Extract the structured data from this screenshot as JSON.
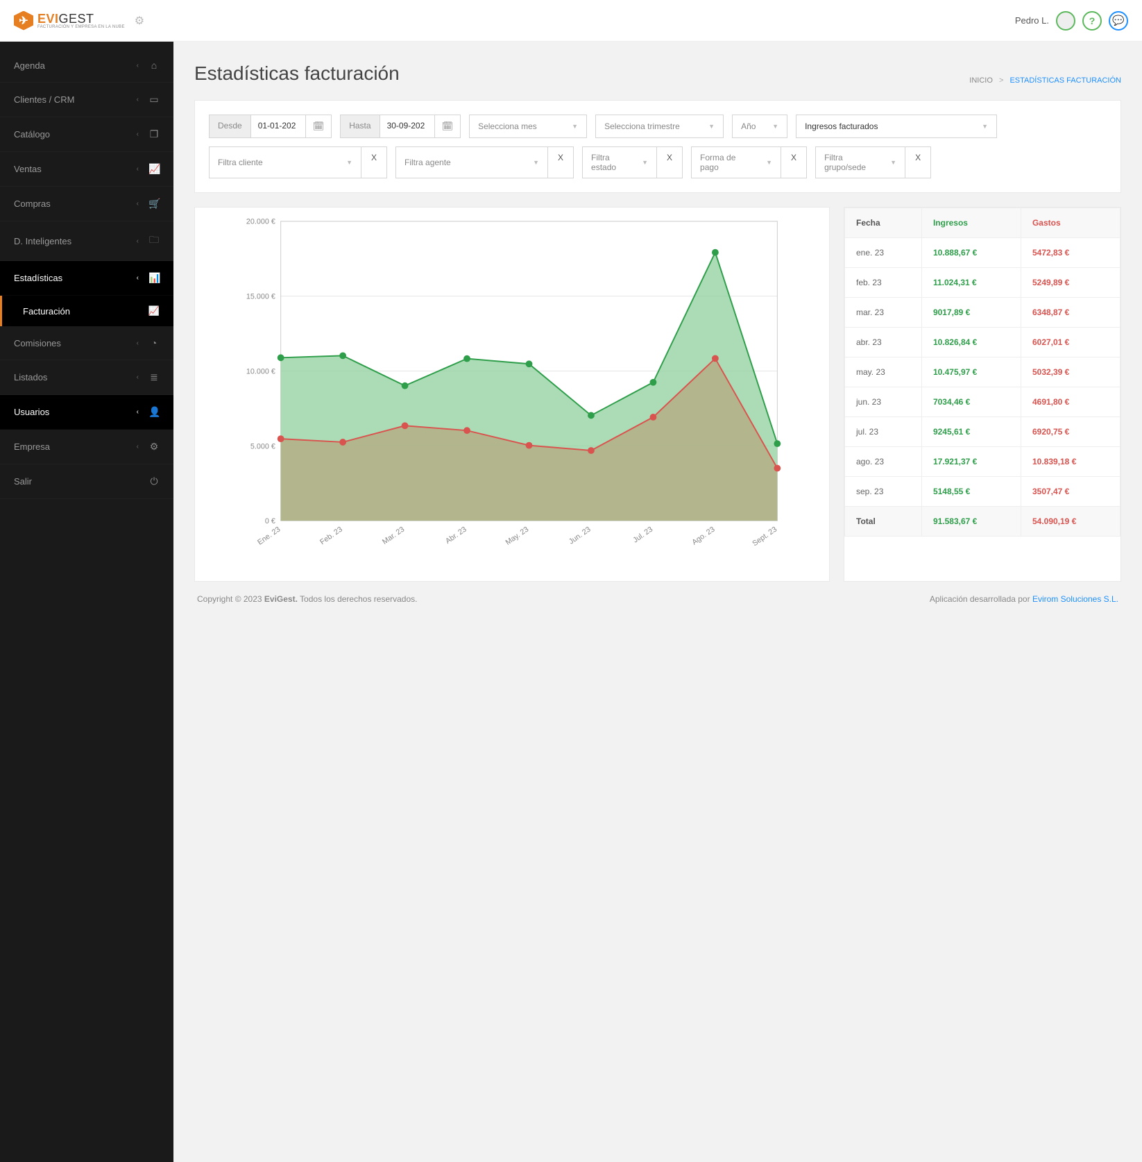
{
  "header": {
    "user_name": "Pedro L.",
    "logo_main": "EVI",
    "logo_sub": "GEST",
    "logo_tag": "FACTURACIÓN Y EMPRESA EN LA NUBE"
  },
  "sidebar": {
    "items": [
      {
        "label": "Agenda",
        "icon": "⌂"
      },
      {
        "label": "Clientes / CRM",
        "icon": "▭"
      },
      {
        "label": "Catálogo",
        "icon": "❐"
      },
      {
        "label": "Ventas",
        "icon": "📈"
      },
      {
        "label": "Compras",
        "icon": "🛒"
      },
      {
        "label": "D. Inteligentes",
        "icon": "🗀"
      },
      {
        "label": "Estadísticas",
        "icon": "📊"
      },
      {
        "label": "Comisiones",
        "icon": "◔"
      },
      {
        "label": "Listados",
        "icon": "≣"
      },
      {
        "label": "Usuarios",
        "icon": "👤"
      },
      {
        "label": "Empresa",
        "icon": "⚙"
      },
      {
        "label": "Salir",
        "icon": "⏻"
      }
    ],
    "sub_facturacion": "Facturación"
  },
  "page": {
    "title": "Estadísticas facturación",
    "bc_home": "INICIO",
    "bc_sep": ">",
    "bc_current": "ESTADÍSTICAS FACTURACIÓN"
  },
  "filters": {
    "desde_lbl": "Desde",
    "desde_val": "01-01-202",
    "hasta_lbl": "Hasta",
    "hasta_val": "30-09-202",
    "mes": "Selecciona mes",
    "trim": "Selecciona trimestre",
    "ano": "Año",
    "tipo": "Ingresos facturados",
    "cliente": "Filtra cliente",
    "agente": "Filtra agente",
    "estado": "Filtra estado",
    "pago": "Forma de pago",
    "sede": "Filtra grupo/sede",
    "x": "X"
  },
  "table": {
    "h_fecha": "Fecha",
    "h_ing": "Ingresos",
    "h_gas": "Gastos",
    "rows": [
      {
        "fecha": "ene. 23",
        "ing": "10.888,67 €",
        "gas": "5472,83 €"
      },
      {
        "fecha": "feb. 23",
        "ing": "11.024,31 €",
        "gas": "5249,89 €"
      },
      {
        "fecha": "mar. 23",
        "ing": "9017,89 €",
        "gas": "6348,87 €"
      },
      {
        "fecha": "abr. 23",
        "ing": "10.826,84 €",
        "gas": "6027,01 €"
      },
      {
        "fecha": "may. 23",
        "ing": "10.475,97 €",
        "gas": "5032,39 €"
      },
      {
        "fecha": "jun. 23",
        "ing": "7034,46 €",
        "gas": "4691,80 €"
      },
      {
        "fecha": "jul. 23",
        "ing": "9245,61 €",
        "gas": "6920,75 €"
      },
      {
        "fecha": "ago. 23",
        "ing": "17.921,37 €",
        "gas": "10.839,18 €"
      },
      {
        "fecha": "sep. 23",
        "ing": "5148,55 €",
        "gas": "3507,47 €"
      }
    ],
    "total_lbl": "Total",
    "total_ing": "91.583,67 €",
    "total_gas": "54.090,19 €"
  },
  "chart_data": {
    "type": "line",
    "title": "",
    "xlabel": "",
    "ylabel": "",
    "ylim": [
      0,
      20000
    ],
    "yticks": [
      "0 €",
      "5.000 €",
      "10.000 €",
      "15.000 €",
      "20.000 €"
    ],
    "categories": [
      "Ene. 23",
      "Feb. 23",
      "Mar. 23",
      "Abr. 23",
      "May. 23",
      "Jun. 23",
      "Jul. 23",
      "Ago. 23",
      "Sept. 23"
    ],
    "series": [
      {
        "name": "Ingresos",
        "values": [
          10888.67,
          11024.31,
          9017.89,
          10826.84,
          10475.97,
          7034.46,
          9245.61,
          17921.37,
          5148.55
        ]
      },
      {
        "name": "Gastos",
        "values": [
          5472.83,
          5249.89,
          6348.87,
          6027.01,
          5032.39,
          4691.8,
          6920.75,
          10839.18,
          3507.47
        ]
      }
    ]
  },
  "footer": {
    "copy_pre": "Copyright © 2023 ",
    "copy_brand": "EviGest.",
    "copy_post": " Todos los derechos reservados.",
    "dev_pre": "Aplicación desarrollada por ",
    "dev_link": "Evirom Soluciones S.L."
  }
}
